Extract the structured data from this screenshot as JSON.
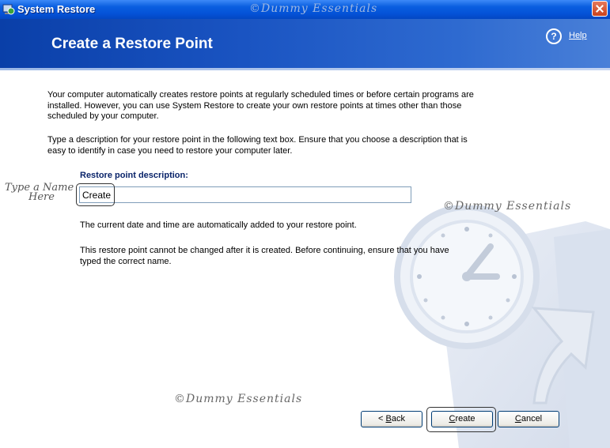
{
  "window": {
    "title": "System Restore",
    "icons": {
      "app": "system-restore-icon",
      "close": "close-icon"
    }
  },
  "watermark": "©Dummy Essentials",
  "header": {
    "title": "Create a Restore Point",
    "help_label": "Help",
    "help_icon_glyph": "?"
  },
  "body": {
    "para1": "Your computer automatically creates restore points at regularly scheduled times or before certain programs are installed. However, you can use System Restore to create your own restore points at times other than those scheduled by your computer.",
    "para2": "Type a description for your restore point in the following text box. Ensure that you choose a description that is easy to identify in case you need to restore your computer later.",
    "field_label": "Restore point description:",
    "field_value": "Create",
    "para3": "The current date and time are automatically added to your restore point.",
    "para4": "This restore point cannot be changed after it is created. Before continuing, ensure that you have typed the correct name."
  },
  "annotation": {
    "line1": "Type a Name",
    "line2": "Here"
  },
  "buttons": {
    "back_prefix": "< ",
    "back_ul": "B",
    "back_rest": "ack",
    "create_ul": "C",
    "create_rest": "reate",
    "cancel_ul": "C",
    "cancel_rest": "ancel"
  },
  "colors": {
    "title_bar": "#0453d8",
    "header_band": "#1a54c2",
    "label_blue": "#0a246a"
  }
}
